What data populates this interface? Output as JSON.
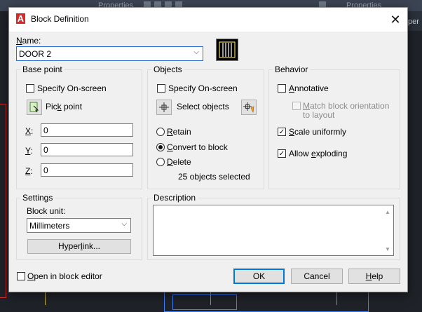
{
  "background": {
    "ribbon_left": "Properties",
    "ribbon_right": "Properties",
    "side_panel_text": "per",
    "colors": {
      "dark_bg": "#1f2329",
      "ribbon": "#3b4453",
      "red_frame": "#d62b2b",
      "blue_geom": "#3d7dff"
    }
  },
  "dialog": {
    "title": "Block Definition",
    "app_icon": "autocad-a-icon",
    "close_glyph": "✕",
    "name": {
      "label_u": "N",
      "label_rest": "ame:",
      "value": "DOOR 2"
    },
    "preview_icon": "block-preview-icon",
    "base_point": {
      "title": "Base point",
      "specify_label": "Specify On-screen",
      "pick_u": "k",
      "pick_pre": "Pic",
      "pick_post": " point",
      "x_u": "X",
      "y_u": "Y",
      "z_u": "Z",
      "x_value": "0",
      "y_value": "0",
      "z_value": "0"
    },
    "objects": {
      "title": "Objects",
      "specify_label": "Specify On-screen",
      "select_label": "Select objects",
      "retain_u": "R",
      "retain_rest": "etain",
      "convert_u": "C",
      "convert_rest": "onvert to block",
      "delete_u": "D",
      "delete_rest": "elete",
      "count_text": "25 objects selected",
      "selected_option": "convert"
    },
    "behavior": {
      "title": "Behavior",
      "annotative_u": "A",
      "annotative_rest": "nnotative",
      "match_u": "M",
      "match_rest": "atch block orientation",
      "match_line2": "to layout",
      "scale_u": "S",
      "scale_rest": "cale uniformly",
      "explode_pre": "Allow ",
      "explode_u": "e",
      "explode_post": "xploding",
      "annotative_checked": false,
      "match_checked": false,
      "scale_checked": true,
      "explode_checked": true
    },
    "settings": {
      "title": "Settings",
      "block_unit_label": "Block unit:",
      "block_unit_value": "Millimeters",
      "hyperlink_pre": "Hyper",
      "hyperlink_u": "l",
      "hyperlink_post": "ink..."
    },
    "description": {
      "title": "Description",
      "value": ""
    },
    "open_editor": {
      "u": "O",
      "rest": "pen in block editor",
      "checked": false
    },
    "buttons": {
      "ok": "OK",
      "cancel": "Cancel",
      "help_u": "H",
      "help_rest": "elp"
    }
  }
}
